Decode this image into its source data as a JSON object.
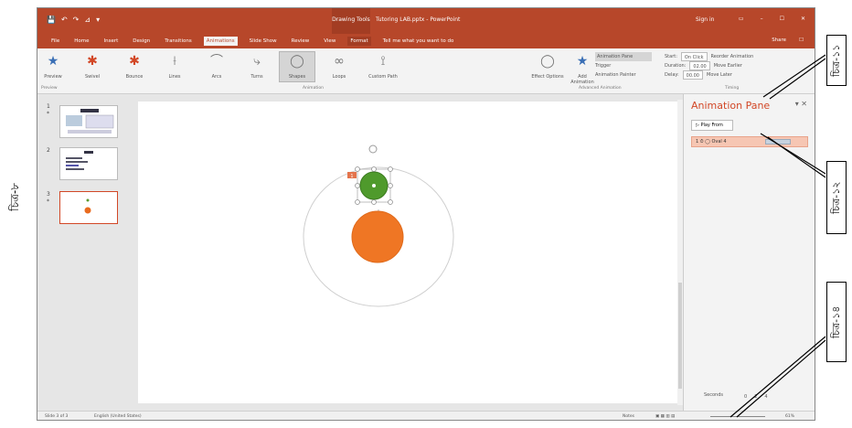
{
  "title_bar": {
    "quick_access": [
      "💾",
      "↶",
      "↷",
      "⊿",
      "▾"
    ],
    "context_tools": "Drawing Tools",
    "doc_title": "Tutoring LAB.pptx - PowerPoint",
    "signin": "Sign in",
    "window_buttons": [
      "▭",
      "–",
      "☐",
      "✕"
    ]
  },
  "tabs": [
    "File",
    "Home",
    "Insert",
    "Design",
    "Transitions",
    "Animations",
    "Slide Show",
    "Review",
    "View",
    "Format",
    "Tell me what you want to do"
  ],
  "share": {
    "share_label": "Share",
    "comment": "☐"
  },
  "ribbon": {
    "preview": "Preview",
    "effects": [
      {
        "label": "Swivel",
        "icon": "✱"
      },
      {
        "label": "Bounce",
        "icon": "✱"
      },
      {
        "label": "Lines",
        "icon": "⟊"
      },
      {
        "label": "Arcs",
        "icon": "⌒"
      },
      {
        "label": "Turns",
        "icon": "⤷"
      },
      {
        "label": "Shapes",
        "icon": "◯"
      },
      {
        "label": "Loops",
        "icon": "∞"
      },
      {
        "label": "Custom Path",
        "icon": "⟟"
      }
    ],
    "effect_options": "Effect Options",
    "add_animation": "Add Animation",
    "advanced": [
      "Animation Pane",
      "Trigger",
      "Animation Painter"
    ],
    "timing": {
      "start_label": "Start:",
      "start_value": "On Click",
      "duration_label": "Duration:",
      "duration_value": "02.00",
      "delay_label": "Delay:",
      "delay_value": "00.00",
      "reorder": "Reorder Animation",
      "move_earlier": "Move Earlier",
      "move_later": "Move Later"
    },
    "groups": [
      "Preview",
      "Animation",
      "Advanced Animation",
      "Timing"
    ]
  },
  "slides": [
    {
      "n": "1",
      "star": "*"
    },
    {
      "n": "2",
      "star": ""
    },
    {
      "n": "3",
      "star": "*"
    }
  ],
  "pane": {
    "title": "Animation Pane",
    "play_from": "Play From",
    "item": "1 ⏱ ◯ Oval 4",
    "seconds": "Seconds",
    "page_nums": [
      "0",
      "2",
      "4"
    ]
  },
  "slide_canvas": {
    "tag": "1"
  },
  "status": {
    "slide_info": "Slide 3 of 3",
    "language": "English (United States)",
    "notes": "Notes",
    "zoom": "61%"
  },
  "annotations": {
    "left": "চিত্র-৮",
    "a1": "চিত্র-১১",
    "a2": "চিত্র-১২",
    "a3": "চিত্র-১৪"
  }
}
